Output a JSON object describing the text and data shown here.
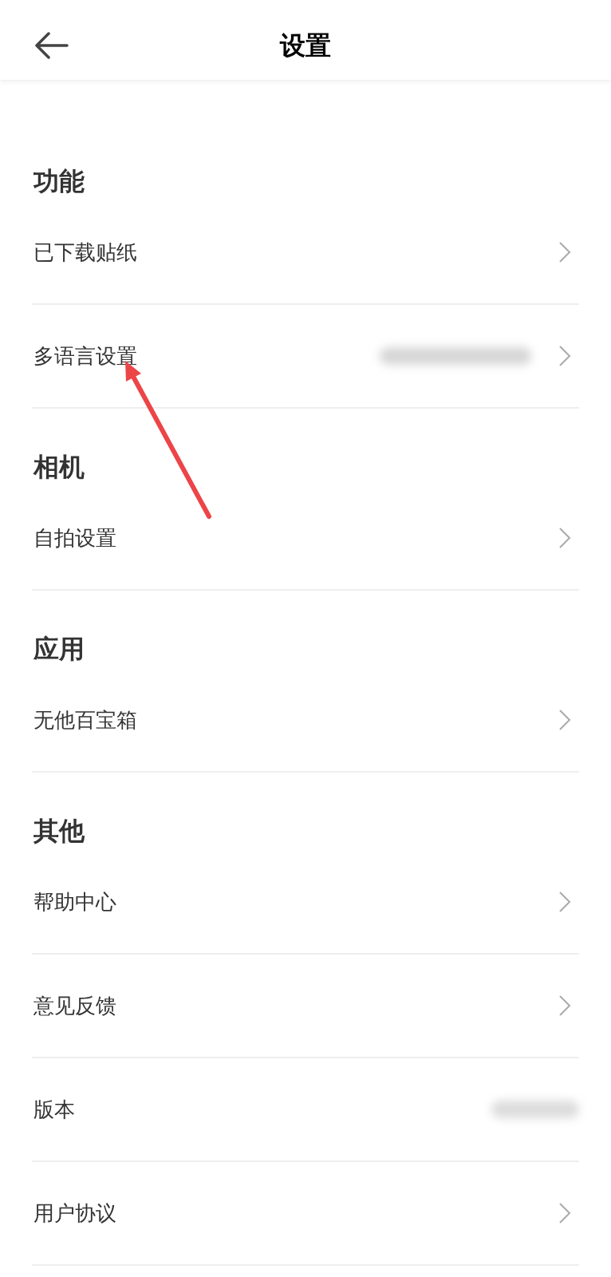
{
  "header": {
    "title": "设置"
  },
  "sections": [
    {
      "heading": "功能",
      "items": [
        {
          "label": "已下载贴纸",
          "chevron": true,
          "value_hidden": false
        },
        {
          "label": "多语言设置",
          "chevron": true,
          "value_hidden": true
        }
      ]
    },
    {
      "heading": "相机",
      "items": [
        {
          "label": "自拍设置",
          "chevron": true,
          "value_hidden": false
        }
      ]
    },
    {
      "heading": "应用",
      "items": [
        {
          "label": "无他百宝箱",
          "chevron": true,
          "value_hidden": false
        }
      ]
    },
    {
      "heading": "其他",
      "items": [
        {
          "label": "帮助中心",
          "chevron": true,
          "value_hidden": false
        },
        {
          "label": "意见反馈",
          "chevron": true,
          "value_hidden": false
        },
        {
          "label": "版本",
          "chevron": false,
          "value_hidden": true
        },
        {
          "label": "用户协议",
          "chevron": true,
          "value_hidden": false
        }
      ]
    }
  ]
}
